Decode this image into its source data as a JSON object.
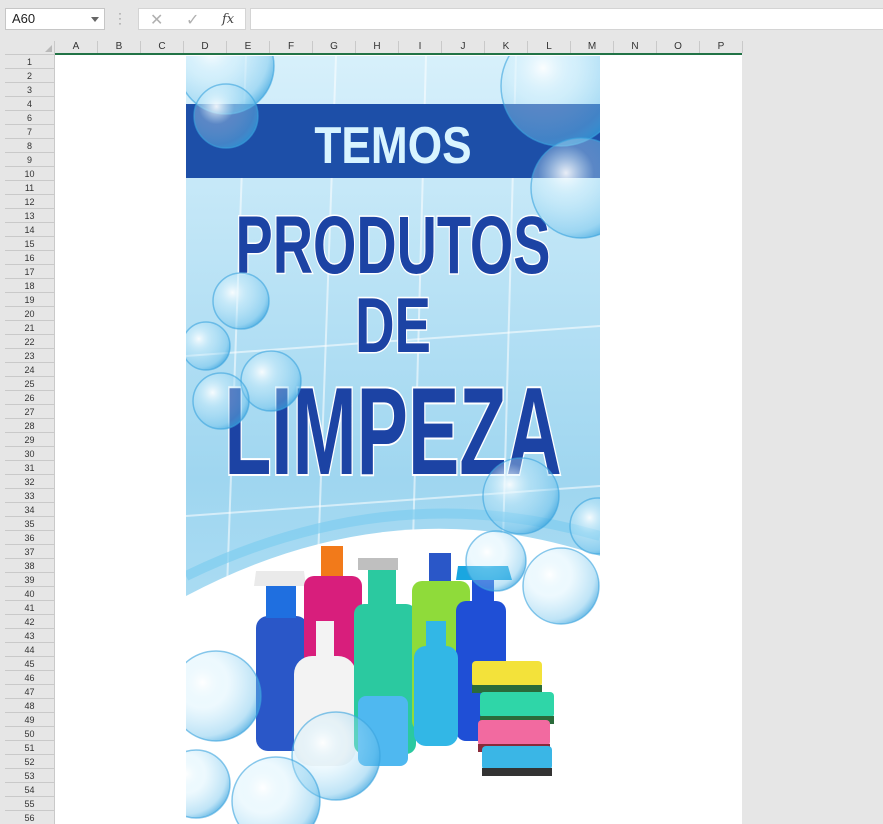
{
  "formula_bar": {
    "name_box": "A60",
    "cancel_icon": "✕",
    "enter_icon": "✓",
    "function_icon": "fx",
    "formula": ""
  },
  "sheet": {
    "columns": [
      "A",
      "B",
      "C",
      "D",
      "E",
      "F",
      "G",
      "H",
      "I",
      "J",
      "K",
      "L",
      "M",
      "N",
      "O",
      "P"
    ],
    "rows": [
      "1",
      "2",
      "3",
      "4",
      "6",
      "7",
      "8",
      "9",
      "10",
      "11",
      "12",
      "13",
      "14",
      "15",
      "16",
      "17",
      "18",
      "19",
      "20",
      "21",
      "22",
      "23",
      "24",
      "25",
      "26",
      "27",
      "28",
      "29",
      "30",
      "31",
      "32",
      "33",
      "34",
      "35",
      "36",
      "37",
      "38",
      "39",
      "40",
      "41",
      "42",
      "43",
      "44",
      "45",
      "46",
      "47",
      "48",
      "49",
      "50",
      "51",
      "52",
      "53",
      "54",
      "55",
      "56"
    ]
  },
  "poster": {
    "line1": "TEMOS",
    "line2": "PRODUTOS",
    "line3": "DE",
    "line4": "LIMPEZA"
  },
  "colors": {
    "sky": "#bfe6f6",
    "banner": "#1d4fa8",
    "title": "#1c43a4",
    "grid_accent": "#217346"
  }
}
